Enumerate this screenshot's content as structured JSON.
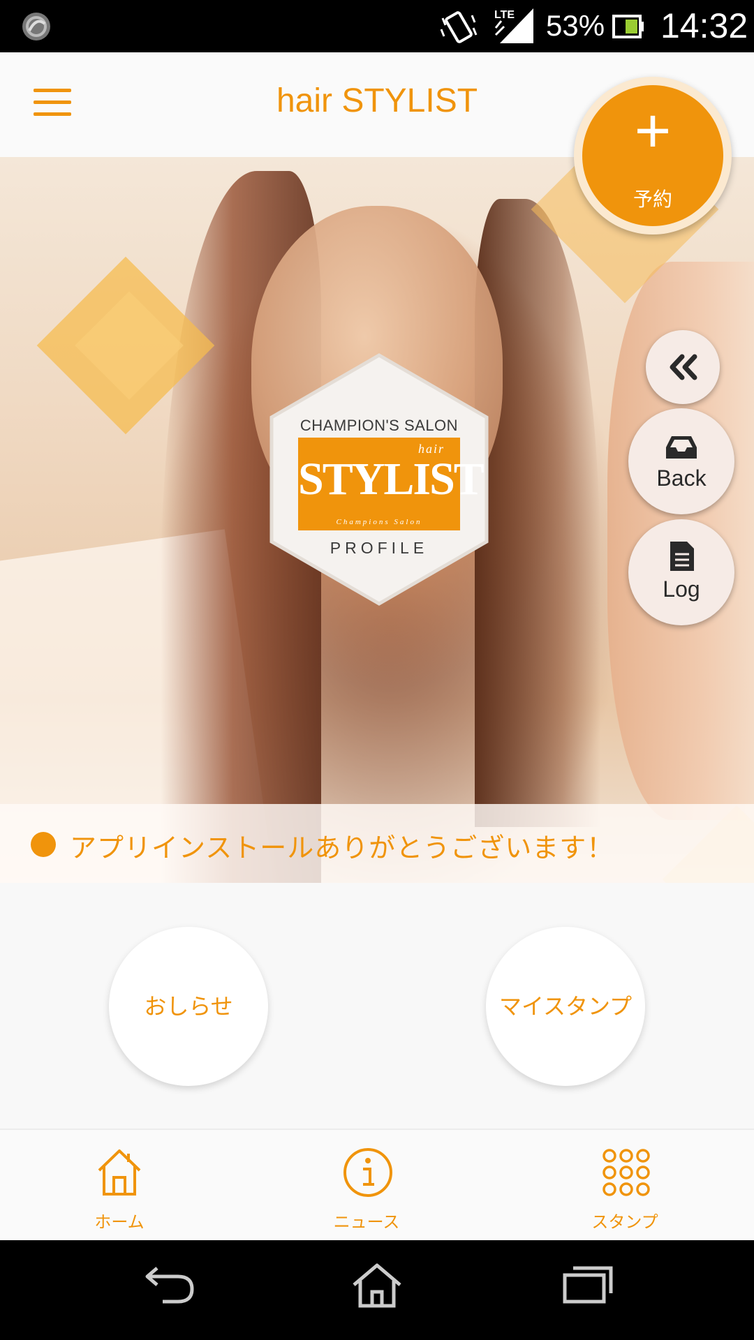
{
  "status_bar": {
    "battery_percent": "53%",
    "time": "14:32",
    "network": "LTE",
    "icons": [
      "app-notification-icon",
      "vibrate-icon",
      "lte-signal-icon",
      "battery-icon"
    ]
  },
  "app_bar": {
    "title": "hair STYLIST",
    "menu_icon": "hamburger-menu-icon"
  },
  "reserve_fab": {
    "plus": "+",
    "label": "予約"
  },
  "side_buttons": {
    "collapse_icon": "double-chevron-left-icon",
    "back_label": "Back",
    "back_icon": "inbox-tray-icon",
    "log_label": "Log",
    "log_icon": "document-icon"
  },
  "hero": {
    "logo": {
      "top_text": "CHAMPION'S SALON",
      "brand_small": "hair",
      "brand": "STYLIST",
      "brand_sub": "Champions Salon",
      "bottom_text": "PROFILE"
    },
    "message": "アプリインストールありがとうございます！"
  },
  "quick_buttons": {
    "news": "おしらせ",
    "stamp": "マイスタンプ"
  },
  "bottom_nav": {
    "items": [
      {
        "label": "ホーム",
        "icon": "home-icon"
      },
      {
        "label": "ニュース",
        "icon": "info-icon"
      },
      {
        "label": "スタンプ",
        "icon": "grid-dots-icon"
      }
    ]
  },
  "system_nav": {
    "icons": [
      "back-arrow-icon",
      "home-outline-icon",
      "recent-apps-icon"
    ]
  },
  "colors": {
    "accent": "#f0940c",
    "background": "#f8f8f8",
    "status_bar": "#000000"
  }
}
